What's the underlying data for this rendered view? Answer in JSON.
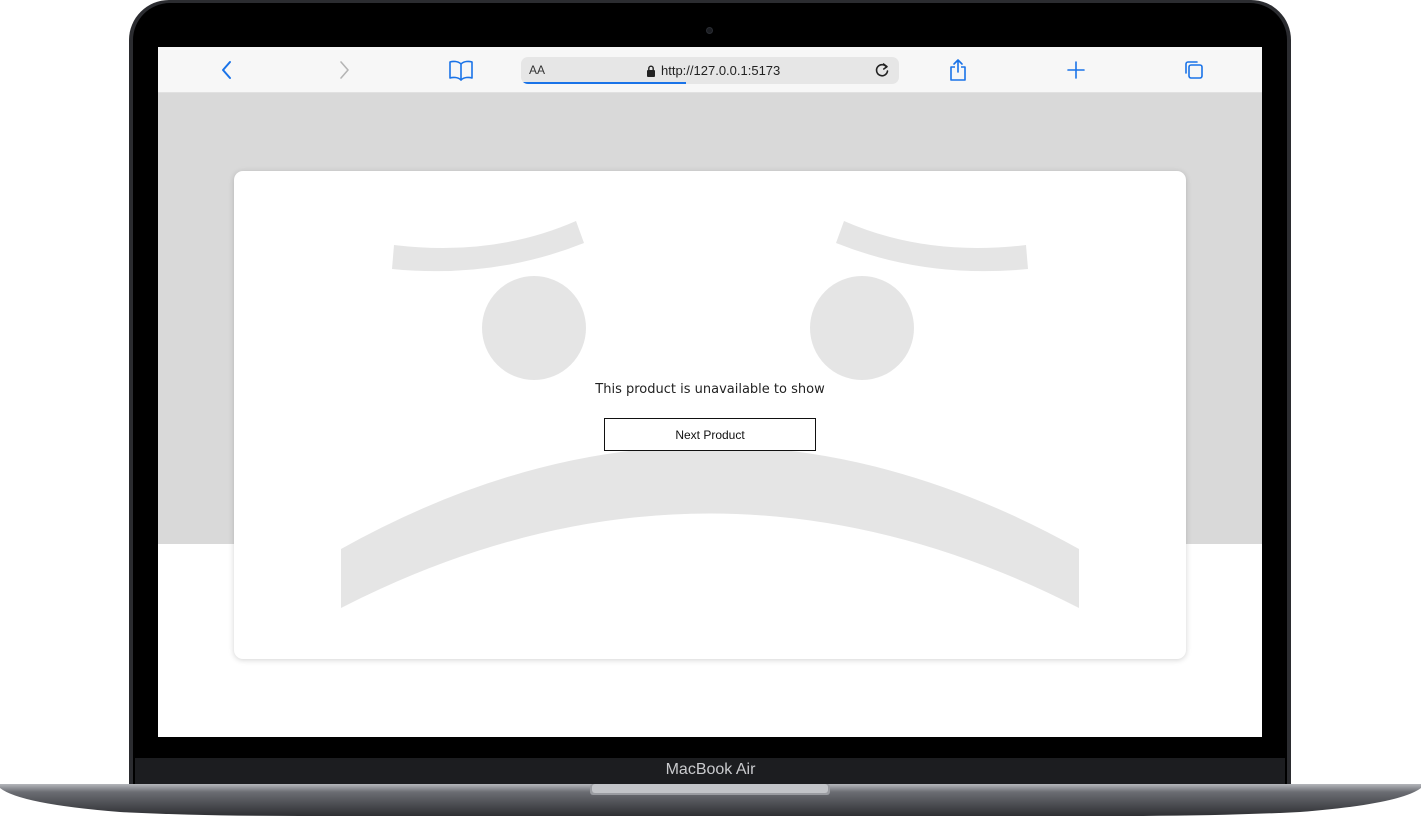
{
  "device": {
    "model_label": "MacBook Air"
  },
  "browser": {
    "reader_label": "AA",
    "url": "http://127.0.0.1:5173",
    "load_progress": 0.43,
    "buttons": {
      "back": "chevron-left-icon",
      "forward": "chevron-right-icon",
      "bookmarks": "book-icon",
      "reload": "reload-icon",
      "share": "share-icon",
      "new_tab": "plus-icon",
      "tabs": "tabs-icon"
    },
    "accent_color": "#1a73e8"
  },
  "page": {
    "message": "This product is unavailable to show",
    "next_button_label": "Next Product",
    "illustration": "sad-face-icon",
    "background_color": "#d9d9d9",
    "illustration_color": "#e5e5e5"
  }
}
